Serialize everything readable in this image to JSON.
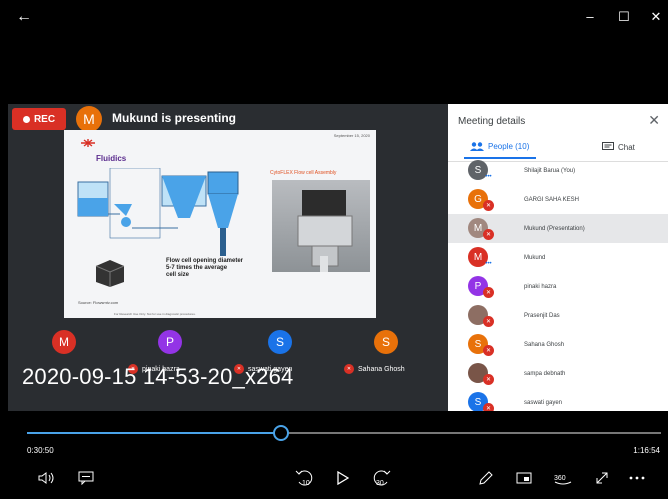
{
  "window": {
    "back_icon": "back-arrow-icon",
    "minimize_glyph": "–",
    "maximize_glyph": "☐",
    "close_glyph": "✕"
  },
  "meeting": {
    "rec_label": "REC",
    "presenter_initial": "M",
    "presenting_text": "Mukund is presenting",
    "accent": "#d93025"
  },
  "slide": {
    "date": "September 15, 2020",
    "title": "Fluidics",
    "right_title": "CytoFLEX Flow cell Assembly",
    "caption_lines": [
      "Flow cell opening diameter",
      "5-7 times the average",
      "cell size"
    ],
    "source": "Source: Flowsmtv.com",
    "footer": "For Research Use Only. Not for use in diagnostic procedures."
  },
  "panel": {
    "title": "Meeting details",
    "tab_people": "People (10)",
    "tab_chat": "Chat",
    "participants": [
      {
        "initial": "S",
        "name": "Shilajit Barua (You)",
        "color": "#5f6368",
        "status": "speaking"
      },
      {
        "initial": "G",
        "name": "GARGI SAHA KESH",
        "color": "#e8710a",
        "status": "muted"
      },
      {
        "initial": "M",
        "name": "Mukund (Presentation)",
        "color": "#a1887f",
        "status": "muted"
      },
      {
        "initial": "M",
        "name": "Mukund",
        "color": "#d93025",
        "status": "speaking"
      },
      {
        "initial": "P",
        "name": "pinaki hazra",
        "color": "#9334e6",
        "status": "muted"
      },
      {
        "initial": "",
        "name": "Prasenjit Das",
        "color": "#8d6e63",
        "status": "muted"
      },
      {
        "initial": "S",
        "name": "Sahana Ghosh",
        "color": "#e8710a",
        "status": "muted"
      },
      {
        "initial": "",
        "name": "sampa debnath",
        "color": "#795548",
        "status": "muted"
      },
      {
        "initial": "S",
        "name": "saswati gayen",
        "color": "#1a73e8",
        "status": "muted"
      }
    ]
  },
  "strip": {
    "tiles": [
      {
        "initial": "M",
        "color": "#d93025"
      },
      {
        "initial": "P",
        "color": "#9334e6"
      },
      {
        "initial": "S",
        "color": "#1a73e8"
      },
      {
        "initial": "S",
        "color": "#e8710a"
      }
    ],
    "names": [
      "pinaki hazra",
      "saswati gayen",
      "Sahana Ghosh"
    ]
  },
  "overlay": {
    "filename": "2020-09-15 14-53-20_x264"
  },
  "player": {
    "current_time": "0:30:50",
    "total_time": "1:16:54",
    "progress_fraction": 0.401,
    "skip_back": "10",
    "skip_forward": "30",
    "accent": "#4aa3e8"
  }
}
